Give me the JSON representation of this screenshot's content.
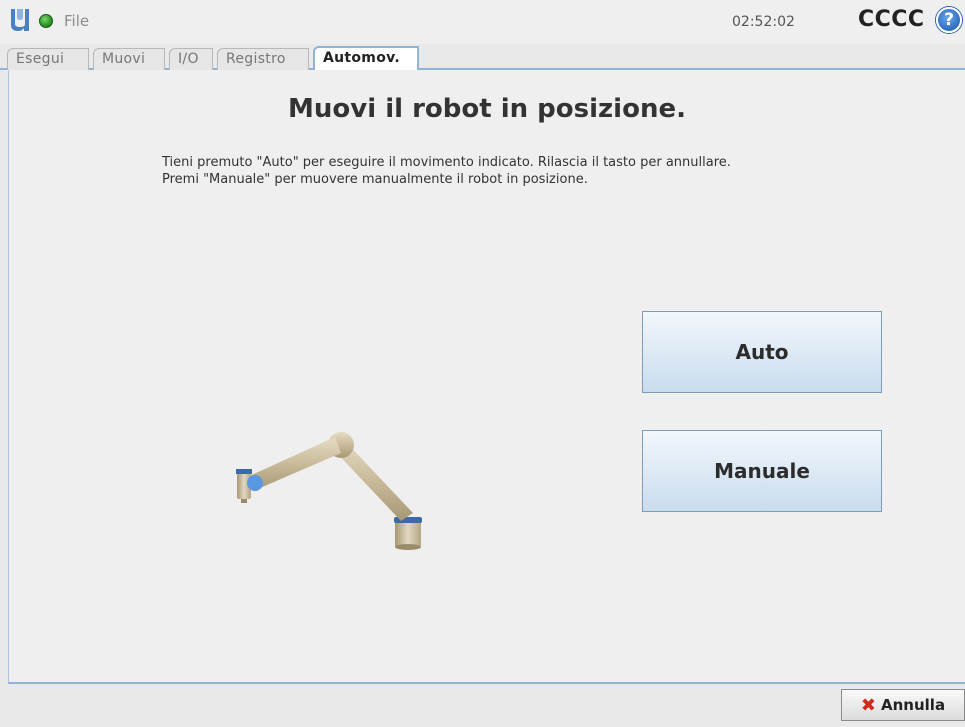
{
  "header": {
    "file_menu": "File",
    "clock": "02:52:02",
    "robot_name": "CCCC",
    "help_glyph": "?",
    "status_color": "#2f9a2a"
  },
  "tabs": [
    {
      "label": "Esegui",
      "active": false
    },
    {
      "label": "Muovi",
      "active": false
    },
    {
      "label": "I/O",
      "active": false
    },
    {
      "label": "Registro",
      "active": false
    },
    {
      "label": "Automov.",
      "active": true
    }
  ],
  "main": {
    "title": "Muovi il robot in posizione.",
    "instruction_line1": "Tieni premuto \"Auto\" per eseguire il movimento indicato. Rilascia il tasto per annullare.",
    "instruction_line2": "Premi \"Manuale\" per muovere manualmente il robot in posizione.",
    "auto_label": "Auto",
    "manual_label": "Manuale"
  },
  "footer": {
    "cancel_label": "Annulla",
    "cancel_icon": "x-icon"
  },
  "colors": {
    "accent": "#8fb4d6",
    "button_top": "#f1f7fc",
    "button_bottom": "#c9dced",
    "cancel_icon": "#d12a1a"
  }
}
